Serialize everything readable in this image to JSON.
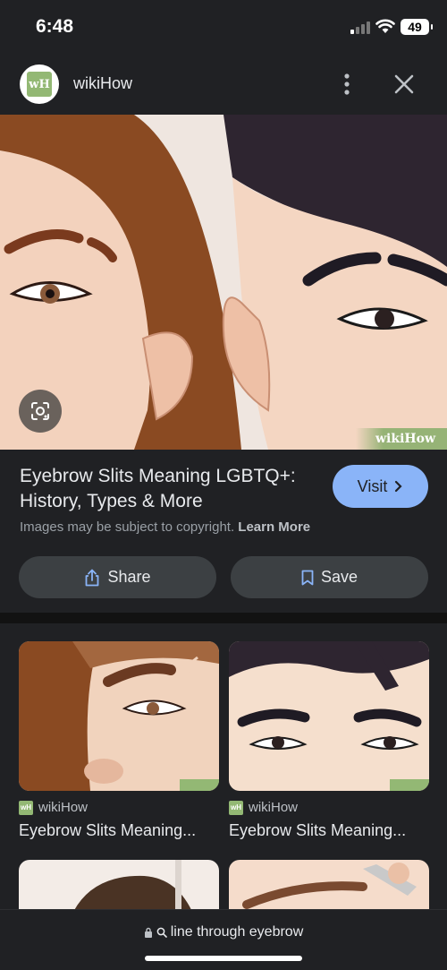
{
  "status_bar": {
    "time": "6:48",
    "battery": "49"
  },
  "header": {
    "site_name": "wikiHow",
    "logo_text": "wH"
  },
  "hero": {
    "watermark": "wikiHow"
  },
  "result": {
    "title": "Eyebrow Slits Meaning LGBTQ+: History, Types & More",
    "visit_label": "Visit",
    "copyright_text": "Images may be subject to copyright.",
    "learn_more": "Learn More",
    "share_label": "Share",
    "save_label": "Save"
  },
  "related": [
    {
      "source": "wikiHow",
      "title": "Eyebrow Slits Meaning..."
    },
    {
      "source": "wikiHow",
      "title": "Eyebrow Slits Meaning..."
    }
  ],
  "address_bar": {
    "query": "line through eyebrow"
  },
  "colors": {
    "accent": "#8ab4f8",
    "background": "#202124",
    "button": "#3c4043"
  }
}
